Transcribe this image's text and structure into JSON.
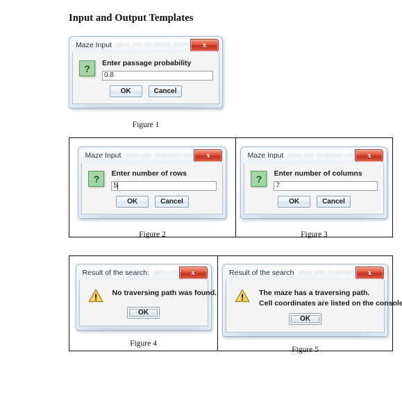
{
  "page": {
    "title": "Input and Output Templates"
  },
  "figure1": {
    "caption": "Figure 1",
    "dialog": {
      "title": "Maze Input",
      "title_blur": "java.util.Scanner.nextInt",
      "close_label": "x",
      "icon": "question-icon",
      "icon_glyph": "?",
      "label": "Enter passage probability",
      "value": "0.8",
      "ok_label": "OK",
      "cancel_label": "Cancel"
    }
  },
  "figure2": {
    "caption": "Figure 2",
    "dialog": {
      "title": "Maze Input",
      "title_blur": "java.util.Scanner.nextInt",
      "close_label": "x",
      "icon": "question-icon",
      "icon_glyph": "?",
      "label": "Enter number of rows",
      "value": "5",
      "ok_label": "OK",
      "cancel_label": "Cancel"
    }
  },
  "figure3": {
    "caption": "Figure 3",
    "dialog": {
      "title": "Maze Input",
      "title_blur": "java.util.Scanner.nextInt",
      "close_label": "x",
      "icon": "question-icon",
      "icon_glyph": "?",
      "label": "Enter number of columns",
      "value": "7",
      "ok_label": "OK",
      "cancel_label": "Cancel"
    }
  },
  "figure4": {
    "caption": "Figure 4",
    "dialog": {
      "title": "Result of the search:",
      "title_blur": "java.util.Scanner.nextInt",
      "close_label": "x",
      "icon": "warning-icon",
      "message_line1": "No traversing path was found.",
      "ok_label": "OK"
    }
  },
  "figure5": {
    "caption": "Figure 5",
    "dialog": {
      "title": "Result of the search",
      "title_blur": "java.util.Scanner.nextInt",
      "close_label": "x",
      "icon": "warning-icon",
      "message_line1": "The maze has a traversing path.",
      "message_line2": "Cell coordinates are listed on the console",
      "ok_label": "OK"
    }
  },
  "colors": {
    "question_icon_fill": "#a6d6a6",
    "question_icon_border": "#5f9a5f",
    "warning_icon_fill": "#f2c94c",
    "close_button": "#c8301b",
    "dialog_frame": "#9fb8cf"
  }
}
